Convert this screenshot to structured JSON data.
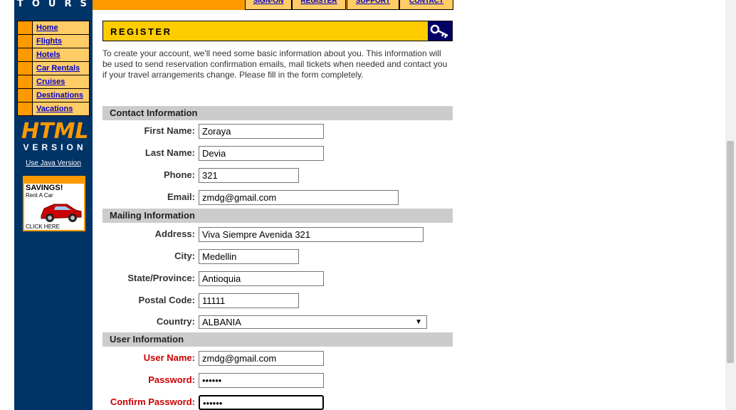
{
  "brand": {
    "name": "TOURS"
  },
  "top_tabs": [
    "SIGN-ON",
    "REGISTER",
    "SUPPORT",
    "CONTACT"
  ],
  "nav": {
    "items": [
      "Home",
      "Flights",
      "Hotels",
      "Car Rentals",
      "Cruises",
      "Destinations",
      "Vacations"
    ]
  },
  "version": {
    "html": "HTML",
    "label": "VERSION",
    "java_link": "Use Java Version"
  },
  "ad": {
    "savings": "SAVINGS!",
    "rent": "Rent A Car",
    "click": "CLICK HERE"
  },
  "register": {
    "title": "REGISTER",
    "intro": "To create your account, we'll need some basic information about you. This information will be used to send reservation confirmation emails, mail tickets when needed and contact you if your travel arrangements change. Please fill in the form completely."
  },
  "contact": {
    "header": "Contact Information",
    "first_name_label": "First Name:",
    "first_name": "Zoraya",
    "last_name_label": "Last Name:",
    "last_name": "Devia",
    "phone_label": "Phone:",
    "phone": "321",
    "email_label": "Email:",
    "email": "zmdg@gmail.com"
  },
  "mailing": {
    "header": "Mailing Information",
    "address_label": "Address:",
    "address": "Viva Siempre Avenida 321",
    "city_label": "City:",
    "city": "Medellin",
    "state_label": "State/Province:",
    "state": "Antioquia",
    "postal_label": "Postal Code:",
    "postal": "11111",
    "country_label": "Country:",
    "country": "ALBANIA"
  },
  "user": {
    "header": "User Information",
    "username_label": "User Name:",
    "username": "zmdg@gmail.com",
    "password_label": "Password:",
    "password": "••••••",
    "confirm_label": "Confirm Password:",
    "confirm": "••••••"
  },
  "colors": {
    "sidebar": "#003366",
    "accent": "#ff9900",
    "register_bar": "#ffcc00",
    "required": "#cc0000"
  }
}
